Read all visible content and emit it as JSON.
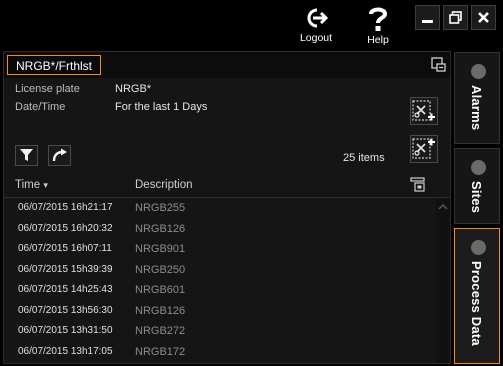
{
  "header": {
    "logout_label": "Logout",
    "help_label": "Help"
  },
  "window_controls": {
    "minimize": "minimize-icon",
    "restore": "restore-icon",
    "close": "close-icon"
  },
  "panel": {
    "title": "NRGB*/Frthlst",
    "filters": [
      {
        "key": "License plate",
        "value": "NRGB*"
      },
      {
        "key": "Date/Time",
        "value": "For the last 1 Days"
      }
    ],
    "item_count": "25 items",
    "columns": {
      "time": "Time",
      "description": "Description",
      "sort_glyph": "▾"
    },
    "rows": [
      {
        "time": "06/07/2015 16h21:17",
        "description": "NRGB255"
      },
      {
        "time": "06/07/2015 16h20:32",
        "description": "NRGB126"
      },
      {
        "time": "06/07/2015 16h07:11",
        "description": "NRGB901"
      },
      {
        "time": "06/07/2015 15h39:39",
        "description": "NRGB250"
      },
      {
        "time": "06/07/2015 14h25:43",
        "description": "NRGB601"
      },
      {
        "time": "06/07/2015 13h56:30",
        "description": "NRGB126"
      },
      {
        "time": "06/07/2015 13h31:50",
        "description": "NRGB272"
      },
      {
        "time": "06/07/2015 13h17:05",
        "description": "NRGB172"
      }
    ]
  },
  "side_tabs": [
    {
      "label": "Alarms",
      "active": false
    },
    {
      "label": "Sites",
      "active": false
    },
    {
      "label": "Process Data",
      "active": true
    }
  ],
  "colors": {
    "accent": "#f28c28",
    "background": "#000000",
    "panel": "#151515",
    "muted_text": "#8c8c8c"
  }
}
